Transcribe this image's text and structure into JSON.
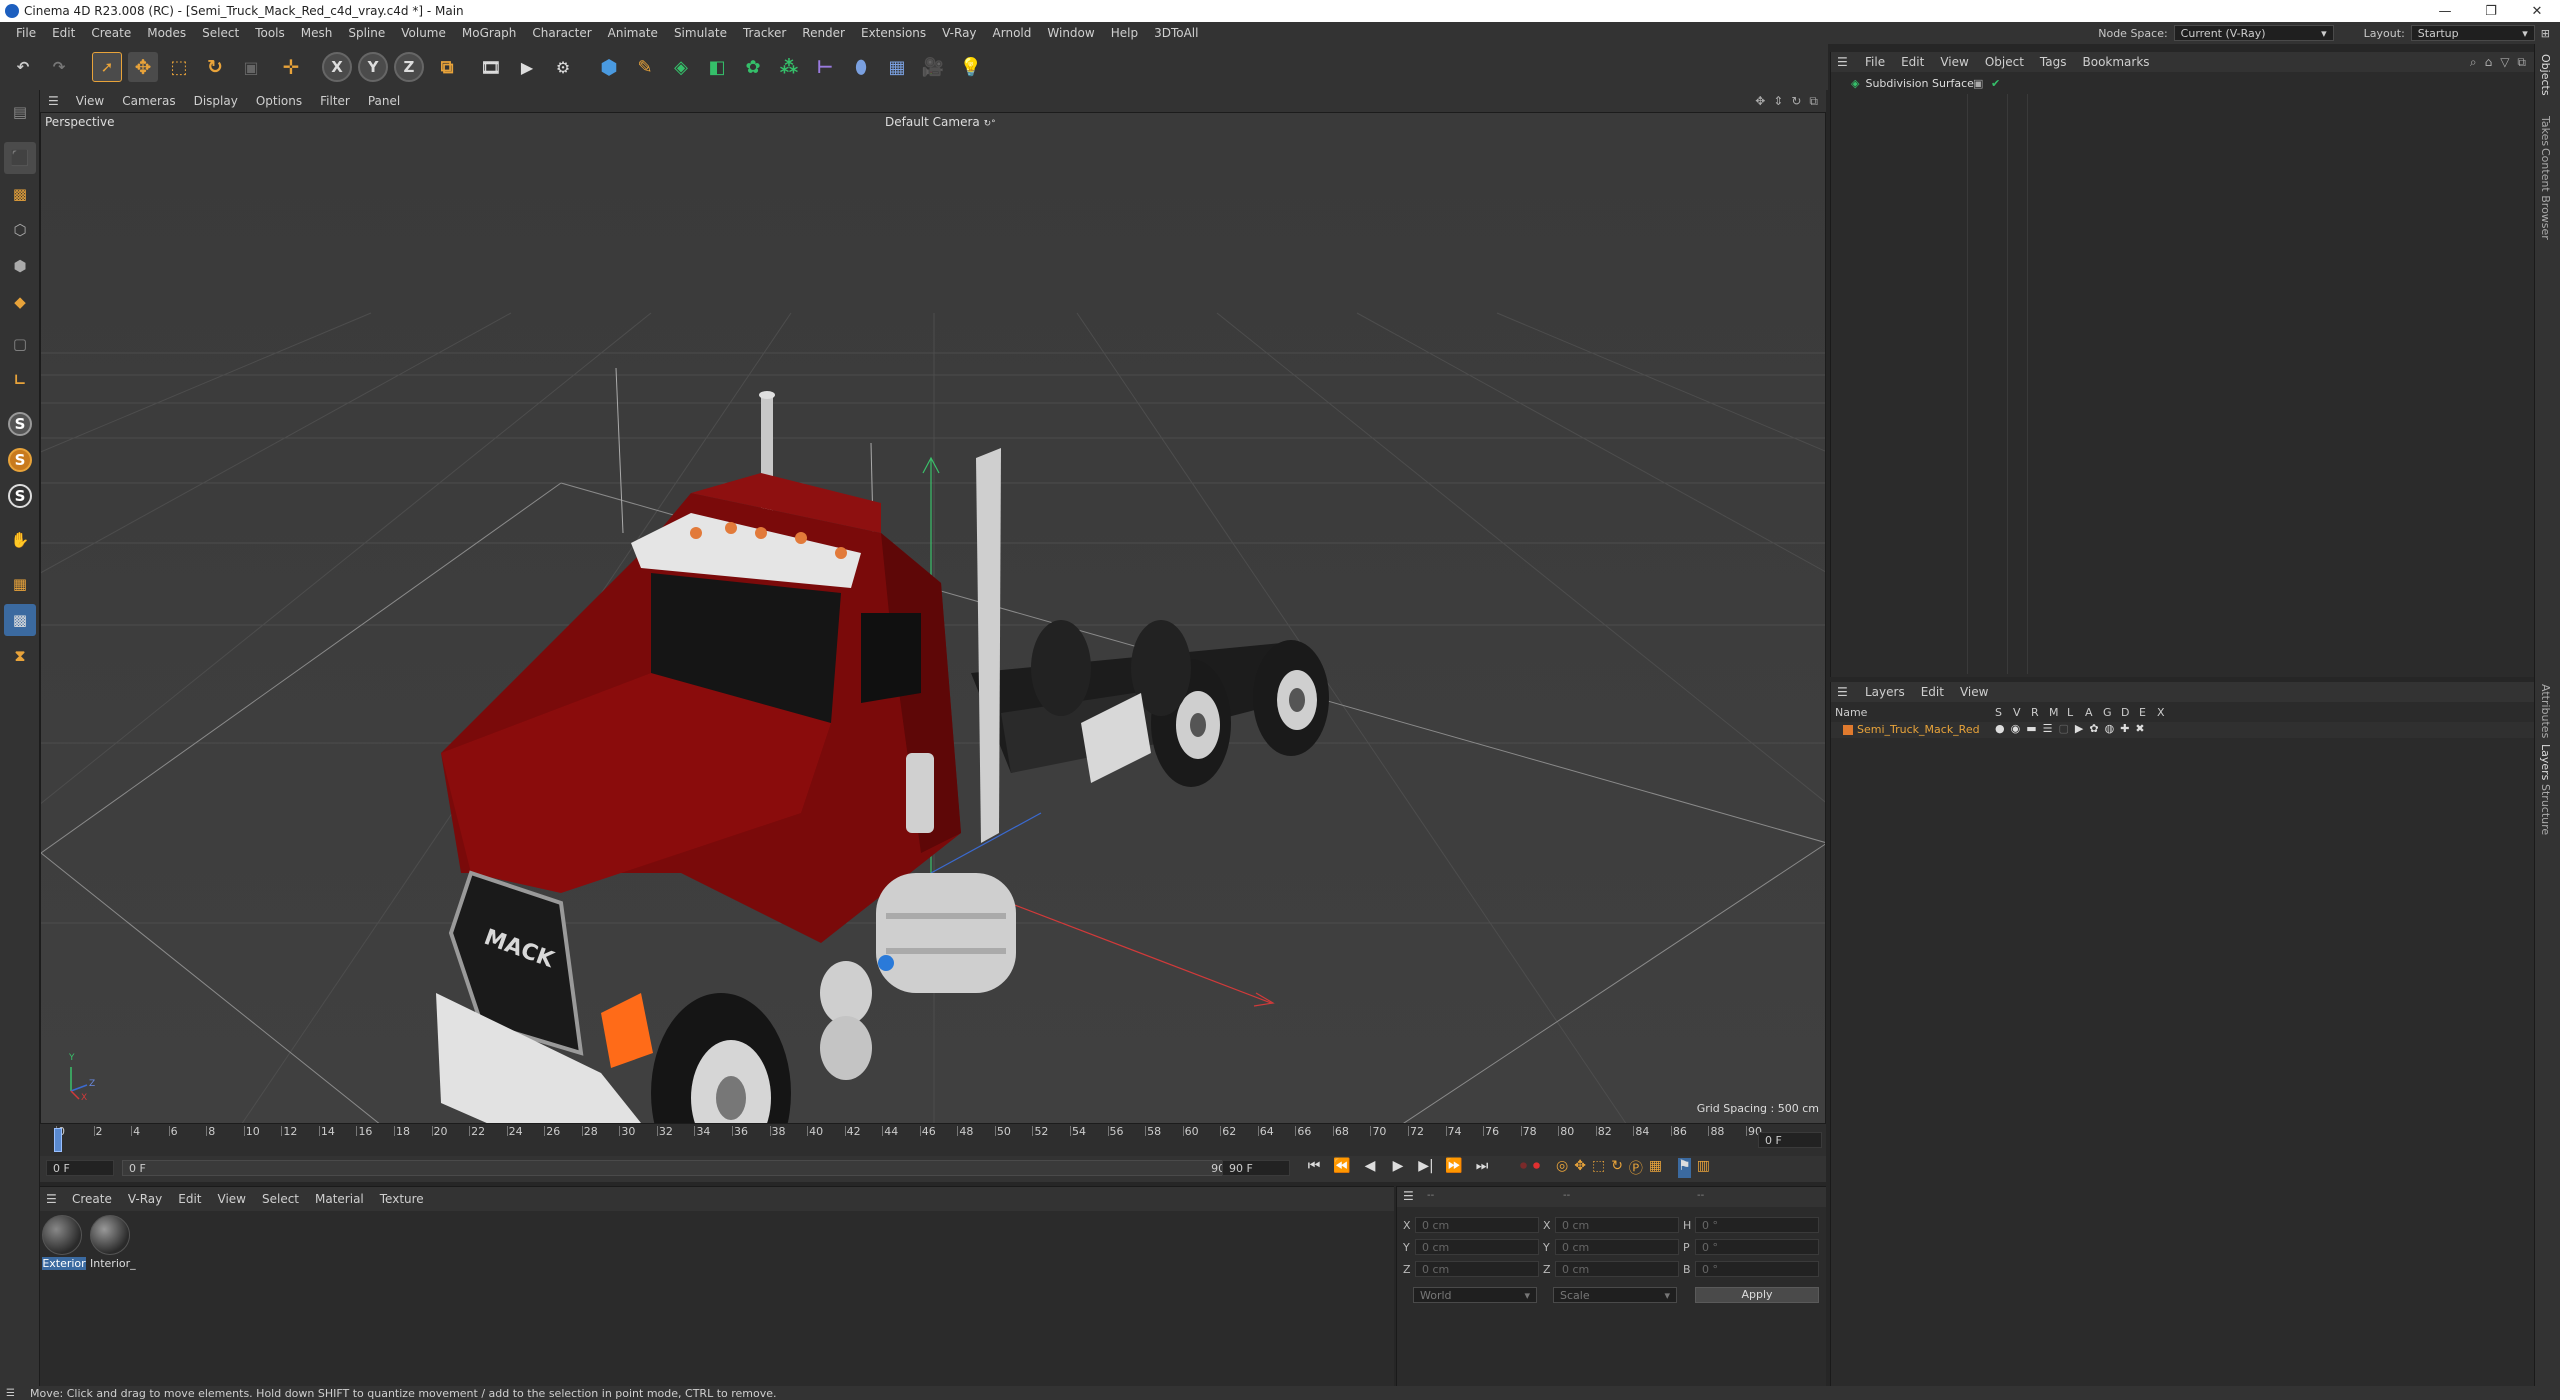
{
  "titlebar": {
    "title": "Cinema 4D R23.008 (RC) - [Semi_Truck_Mack_Red_c4d_vray.c4d *] - Main",
    "min": "—",
    "restore": "❐",
    "close": "✕"
  },
  "menu": [
    "File",
    "Edit",
    "Create",
    "Modes",
    "Select",
    "Tools",
    "Mesh",
    "Spline",
    "Volume",
    "MoGraph",
    "Character",
    "Animate",
    "Simulate",
    "Tracker",
    "Render",
    "Extensions",
    "V-Ray",
    "Arnold",
    "Window",
    "Help",
    "3DToAll"
  ],
  "node_space": {
    "label": "Node Space:",
    "value": "Current (V-Ray)"
  },
  "layout": {
    "label": "Layout:",
    "value": "Startup"
  },
  "toolbar": {
    "x": "X",
    "y": "Y",
    "z": "Z"
  },
  "leftbar": {
    "s1": "S",
    "s2": "S",
    "s3": "S"
  },
  "viewport": {
    "menu": [
      "View",
      "Cameras",
      "Display",
      "Options",
      "Filter",
      "Panel"
    ],
    "projection": "Perspective",
    "camera": "Default Camera",
    "camera_mark": "↻°",
    "grid_spacing": "Grid Spacing : 500 cm",
    "axis_y": "Y",
    "axis_z": "Z",
    "axis_x": "X",
    "grille_text": "MACK"
  },
  "timeline": {
    "ticks": [
      "0",
      "2",
      "4",
      "6",
      "8",
      "10",
      "12",
      "14",
      "16",
      "18",
      "20",
      "22",
      "24",
      "26",
      "28",
      "30",
      "32",
      "34",
      "36",
      "38",
      "40",
      "42",
      "44",
      "46",
      "48",
      "50",
      "52",
      "54",
      "56",
      "58",
      "60",
      "62",
      "64",
      "66",
      "68",
      "70",
      "72",
      "74",
      "76",
      "78",
      "80",
      "82",
      "84",
      "86",
      "88",
      "90"
    ],
    "current_frame": "0 F"
  },
  "transport": {
    "start": "0 F",
    "preview_start": "0 F",
    "preview_end": "90 F",
    "end": "90 F"
  },
  "material_manager": {
    "menu": [
      "Create",
      "V-Ray",
      "Edit",
      "View",
      "Select",
      "Material",
      "Texture"
    ],
    "materials": [
      {
        "name": "Exterior"
      },
      {
        "name": "Interior_"
      }
    ]
  },
  "coordinates": {
    "header": [
      "--",
      "--",
      "--"
    ],
    "rows": [
      {
        "a": "X",
        "av": "0 cm",
        "b": "X",
        "bv": "0 cm",
        "c": "H",
        "cv": "0 °"
      },
      {
        "a": "Y",
        "av": "0 cm",
        "b": "Y",
        "bv": "0 cm",
        "c": "P",
        "cv": "0 °"
      },
      {
        "a": "Z",
        "av": "0 cm",
        "b": "Z",
        "bv": "0 cm",
        "c": "B",
        "cv": "0 °"
      }
    ],
    "mode": "World",
    "transform": "Scale",
    "apply": "Apply"
  },
  "object_manager": {
    "menu": [
      "File",
      "Edit",
      "View",
      "Object",
      "Tags",
      "Bookmarks"
    ],
    "object_name": "Subdivision Surface"
  },
  "layer_manager": {
    "menu": [
      "Layers",
      "Edit",
      "View"
    ],
    "col_name": "Name",
    "flags": [
      "S",
      "V",
      "R",
      "M",
      "L",
      "A",
      "G",
      "D",
      "E",
      "X"
    ],
    "layer_name": "Semi_Truck_Mack_Red",
    "layer_color": "#e07a2e"
  },
  "right_tabs": [
    "Objects",
    "Takes",
    "Content Browser",
    "Attributes",
    "Layers",
    "Structure"
  ],
  "statusbar": "Move: Click and drag to move elements. Hold down SHIFT to quantize movement / add to the selection in point mode, CTRL to remove.",
  "colors": {
    "accent": "#e8a33a",
    "truck_red": "#7a0a0a",
    "selection": "#3b6aa0"
  }
}
